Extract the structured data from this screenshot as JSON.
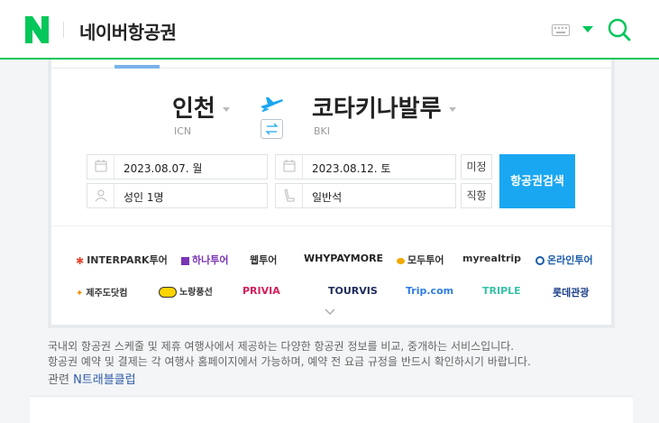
{
  "header": {
    "logo_letter": "N",
    "title": "네이버항공권",
    "brand_color": "#03c75a"
  },
  "route": {
    "origin_city": "인천",
    "origin_code": "ICN",
    "destination_city": "코타키나발루",
    "destination_code": "BKI"
  },
  "form": {
    "depart_date": "2023.08.07. 월",
    "return_date": "2023.08.12. 토",
    "undecided_label": "미정",
    "passengers": "성인 1명",
    "seat_class": "일반석",
    "direct_label": "직항",
    "search_label": "항공권검색",
    "search_color": "#1aa7f1"
  },
  "partners": [
    "INTERPARK투어",
    "하나투어",
    "웹투어",
    "WHYPAYMORE",
    "모두투어",
    "myrealtrip",
    "온라인투어",
    "제주도닷컴",
    "노랑풍선",
    "PRIVIA",
    "TOURVIS",
    "Trip.com",
    "TRIPLE",
    "롯데관광"
  ],
  "footer": {
    "description_line1": "국내외 항공권 스케줄 및 제휴 여행사에서 제공하는 다양한 항공권 정보를 비교, 중개하는 서비스입니다.",
    "description_line2": "항공권 예약 및 결제는 각 여행사 홈페이지에서 가능하며, 예약 전 요금 규정을 반드시 확인하시기 바랍니다.",
    "related_label": "관련",
    "related_link": "N트래블클럽"
  }
}
